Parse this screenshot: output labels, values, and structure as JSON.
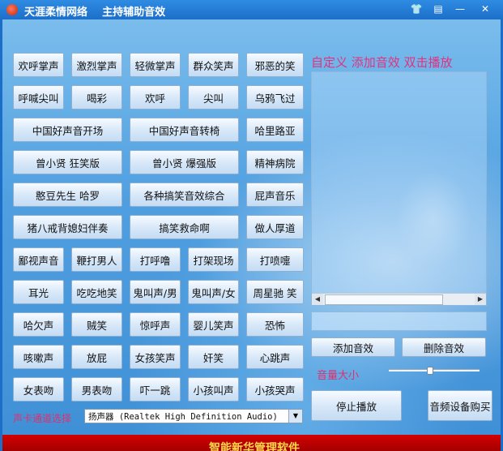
{
  "window": {
    "title": "天涯柔情网络    主持辅助音效",
    "buttons": {
      "skin": "👕",
      "menu": "▤",
      "minimize": "—",
      "close": "✕"
    }
  },
  "sound_buttons": [
    {
      "label": "欢呼掌声"
    },
    {
      "label": "激烈掌声"
    },
    {
      "label": "轻微掌声"
    },
    {
      "label": "群众笑声"
    },
    {
      "label": "邪恶的笑"
    },
    {
      "label": "呼喊尖叫"
    },
    {
      "label": "喝彩"
    },
    {
      "label": "欢呼"
    },
    {
      "label": "尖叫"
    },
    {
      "label": "乌鸦飞过"
    },
    {
      "label": "中国好声音开场"
    },
    {
      "label": "中国好声音转椅"
    },
    {
      "label": "哈里路亚"
    },
    {
      "label": "曾小贤 狂笑版"
    },
    {
      "label": "曾小贤 爆强版"
    },
    {
      "label": "精神病院"
    },
    {
      "label": "憨豆先生 哈罗"
    },
    {
      "label": "各种搞笑音效综合"
    },
    {
      "label": "屁声音乐"
    },
    {
      "label": "猪八戒背媳妇伴奏"
    },
    {
      "label": "搞笑救命啊"
    },
    {
      "label": "做人厚道"
    },
    {
      "label": "鄙视声音"
    },
    {
      "label": "鞭打男人"
    },
    {
      "label": "打呼噜"
    },
    {
      "label": "打架现场"
    },
    {
      "label": "打喷嚏"
    },
    {
      "label": "耳光"
    },
    {
      "label": "吃吃地笑"
    },
    {
      "label": "鬼叫声/男"
    },
    {
      "label": "鬼叫声/女"
    },
    {
      "label": "周星驰 笑"
    },
    {
      "label": "哈欠声"
    },
    {
      "label": "贼笑"
    },
    {
      "label": "惊呼声"
    },
    {
      "label": "婴儿笑声"
    },
    {
      "label": "恐怖"
    },
    {
      "label": "咳嗽声"
    },
    {
      "label": "放屁"
    },
    {
      "label": "女孩笑声"
    },
    {
      "label": "奸笑"
    },
    {
      "label": "心跳声"
    },
    {
      "label": "女表吻"
    },
    {
      "label": "男表吻"
    },
    {
      "label": "吓一跳"
    },
    {
      "label": "小孩叫声"
    },
    {
      "label": "小孩哭声"
    }
  ],
  "right_panel": {
    "heading": "自定义  添加音效  双击播放",
    "add_button": "添加音效",
    "delete_button": "删除音效",
    "volume_label": "音量大小",
    "volume_level": 0.45,
    "stop_button": "停止播放",
    "buy_button": "音频设备购买"
  },
  "sound_card": {
    "label": "声卡通道选择",
    "selected": "扬声器 (Realtek High Definition Audio)"
  },
  "banner": {
    "text": "智能新华管理软件"
  },
  "colors": {
    "accent_text": "#e0306c",
    "title_bar": "#1c6fc9",
    "banner": "#c00000"
  }
}
